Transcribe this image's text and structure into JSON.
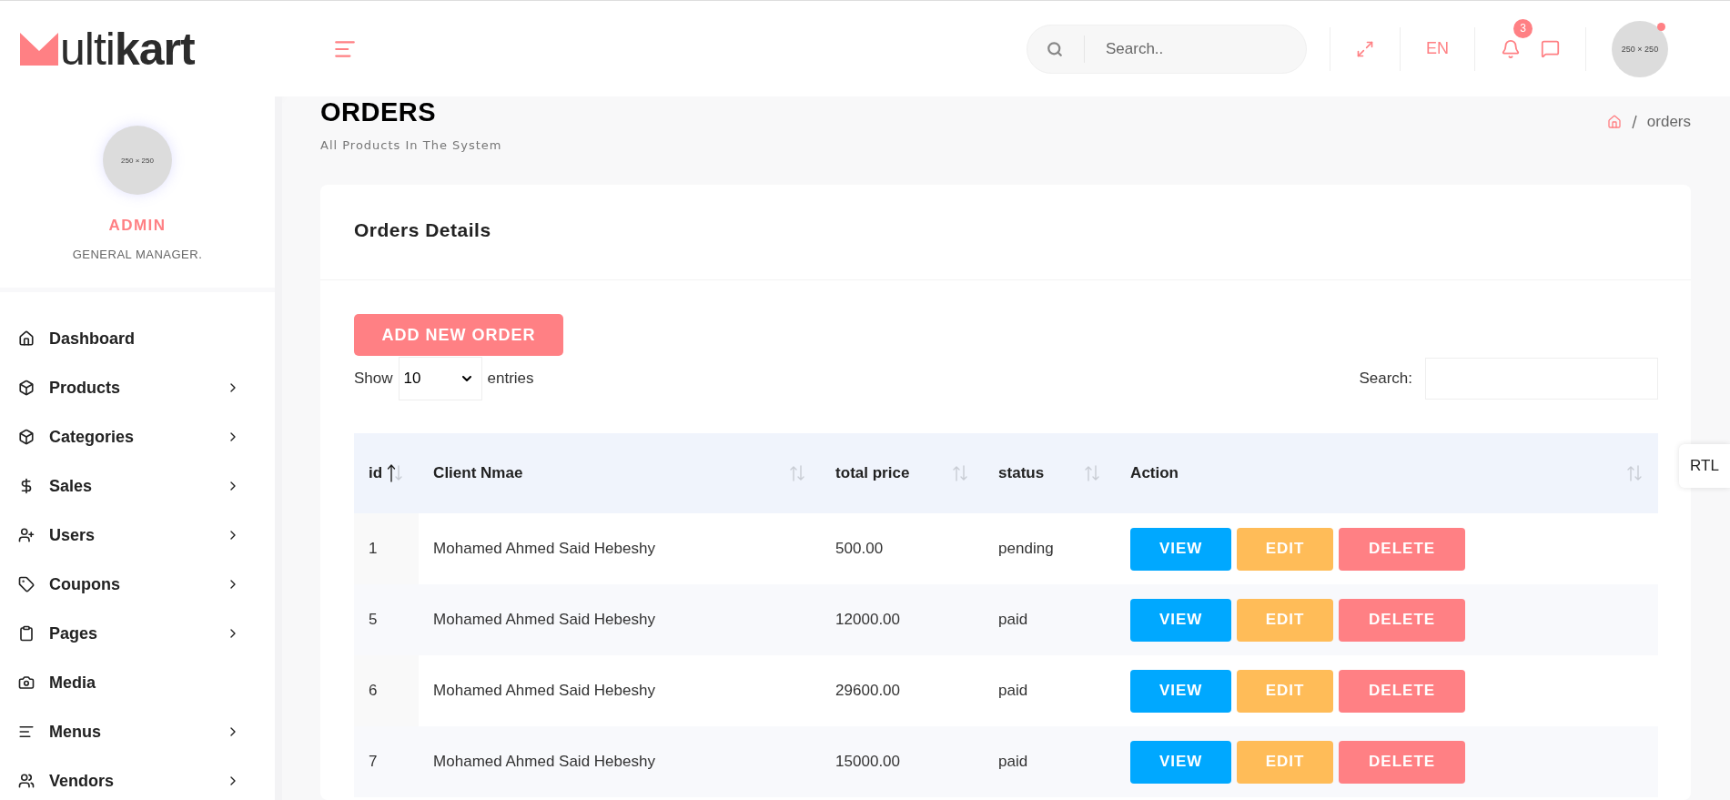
{
  "logo": {
    "text": "ulti**kart**"
  },
  "sidebar": {
    "profile": {
      "avatar_text": "250 × 250",
      "name": "ADMIN",
      "role": "GENERAL MANAGER."
    },
    "items": [
      {
        "label": "Dashboard",
        "submenu": false
      },
      {
        "label": "Products",
        "submenu": true
      },
      {
        "label": "Categories",
        "submenu": true
      },
      {
        "label": "Sales",
        "submenu": true
      },
      {
        "label": "Users",
        "submenu": true
      },
      {
        "label": "Coupons",
        "submenu": true
      },
      {
        "label": "Pages",
        "submenu": true
      },
      {
        "label": "Media",
        "submenu": false
      },
      {
        "label": "Menus",
        "submenu": true
      },
      {
        "label": "Vendors",
        "submenu": true
      }
    ]
  },
  "header": {
    "search": {
      "placeholder": "Search.."
    },
    "language": "EN",
    "notifications": "3",
    "avatar": {
      "avatar_text": "250 × 250",
      "online": true
    }
  },
  "page": {
    "title": "ORDERS",
    "subtitle": "All Products In The System",
    "breadcrumb": [
      "orders"
    ]
  },
  "card": {
    "title": "Orders Details",
    "add_button": "ADD NEW ORDER",
    "show_label": "Show",
    "page_size": "10",
    "entries_label": "entries",
    "search_label": "Search:",
    "table": {
      "columns": [
        {
          "label": "id",
          "sorted": true
        },
        {
          "label": "Client Nmae",
          "sorted": false
        },
        {
          "label": "total price",
          "sorted": false
        },
        {
          "label": "status",
          "sorted": false
        },
        {
          "label": "Action",
          "sorted": false
        }
      ],
      "rows": [
        {
          "id": "1",
          "client": "Mohamed Ahmed Said Hebeshy",
          "total": "500.00",
          "status": "pending",
          "actions": [
            {
              "kind": "view",
              "label": "VIEW"
            },
            {
              "kind": "edit",
              "label": "EDIT"
            },
            {
              "kind": "delete",
              "label": "DELETE"
            }
          ]
        },
        {
          "id": "5",
          "client": "Mohamed Ahmed Said Hebeshy",
          "total": "12000.00",
          "status": "paid",
          "actions": [
            {
              "kind": "view",
              "label": "VIEW"
            },
            {
              "kind": "edit",
              "label": "EDIT"
            },
            {
              "kind": "delete",
              "label": "DELETE"
            }
          ]
        },
        {
          "id": "6",
          "client": "Mohamed Ahmed Said Hebeshy",
          "total": "29600.00",
          "status": "paid",
          "actions": [
            {
              "kind": "view",
              "label": "VIEW"
            },
            {
              "kind": "edit",
              "label": "EDIT"
            },
            {
              "kind": "delete",
              "label": "DELETE"
            }
          ]
        },
        {
          "id": "7",
          "client": "Mohamed Ahmed Said Hebeshy",
          "total": "15000.00",
          "status": "paid",
          "actions": [
            {
              "kind": "view",
              "label": "VIEW"
            },
            {
              "kind": "edit",
              "label": "EDIT"
            },
            {
              "kind": "delete",
              "label": "DELETE"
            }
          ]
        }
      ]
    }
  },
  "rtl_button": "RTL"
}
